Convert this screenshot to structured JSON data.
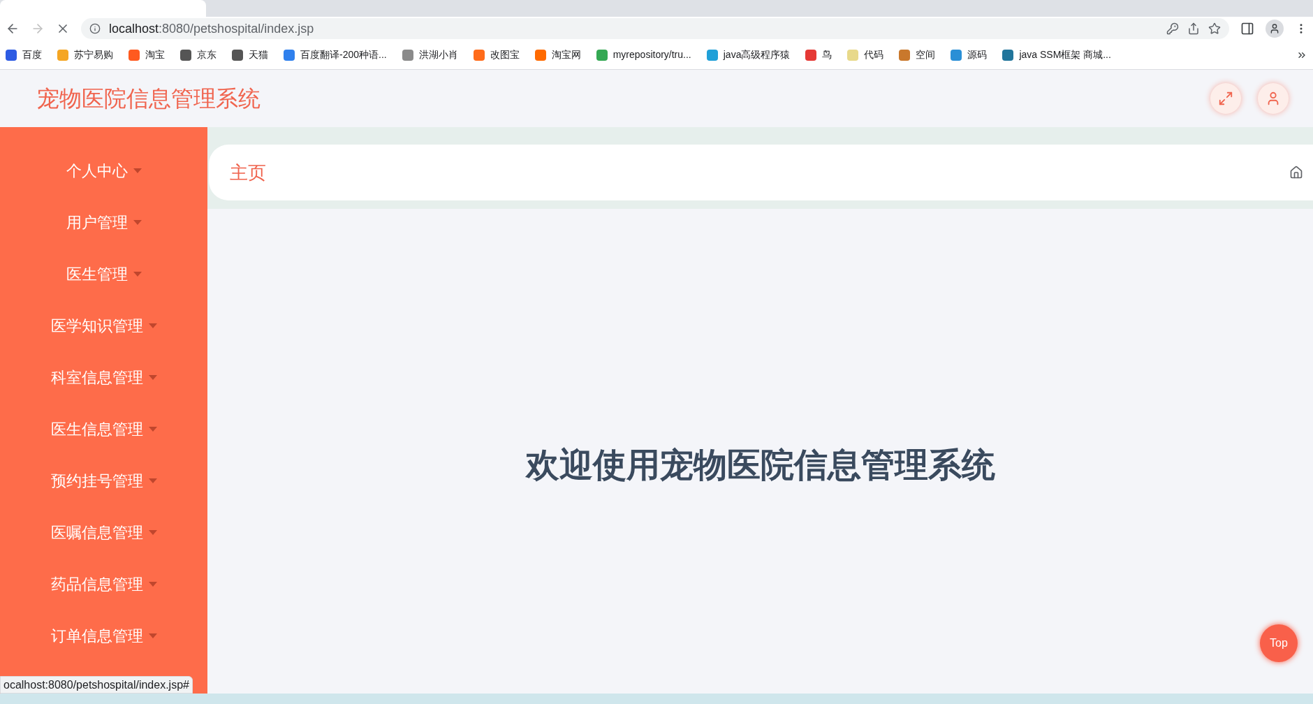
{
  "browser": {
    "url_host": "localhost",
    "url_rest": ":8080/petshospital/index.jsp",
    "bookmarks": [
      {
        "label": "百度",
        "color": "#2d5be3"
      },
      {
        "label": "苏宁易购",
        "color": "#f5a623"
      },
      {
        "label": "淘宝",
        "color": "#ff5a1f"
      },
      {
        "label": "京东",
        "color": "#555555"
      },
      {
        "label": "天猫",
        "color": "#555555"
      },
      {
        "label": "百度翻译-200种语...",
        "color": "#2f80ed"
      },
      {
        "label": "洪湖小肖",
        "color": "#8a8a8a"
      },
      {
        "label": "改图宝",
        "color": "#ff6b1a"
      },
      {
        "label": "淘宝网",
        "color": "#ff6a00"
      },
      {
        "label": "myrepository/tru...",
        "color": "#34a853"
      },
      {
        "label": "java高级程序猿",
        "color": "#20a0d8"
      },
      {
        "label": "鸟",
        "color": "#e53935"
      },
      {
        "label": "代码",
        "color": "#e8d98a"
      },
      {
        "label": "空间",
        "color": "#c9782c"
      },
      {
        "label": "源码",
        "color": "#2a8fd6"
      },
      {
        "label": "java SSM框架 商城...",
        "color": "#21759b"
      }
    ],
    "status_url": "ocalhost:8080/petshospital/index.jsp#"
  },
  "header": {
    "title": "宠物医院信息管理系统"
  },
  "sidebar": {
    "items": [
      {
        "label": "个人中心"
      },
      {
        "label": "用户管理"
      },
      {
        "label": "医生管理"
      },
      {
        "label": "医学知识管理"
      },
      {
        "label": "科室信息管理"
      },
      {
        "label": "医生信息管理"
      },
      {
        "label": "预约挂号管理"
      },
      {
        "label": "医嘱信息管理"
      },
      {
        "label": "药品信息管理"
      },
      {
        "label": "订单信息管理"
      }
    ]
  },
  "breadcrumb": {
    "label": "主页"
  },
  "welcome": "欢迎使用宠物医院信息管理系统",
  "top_button": "Top"
}
